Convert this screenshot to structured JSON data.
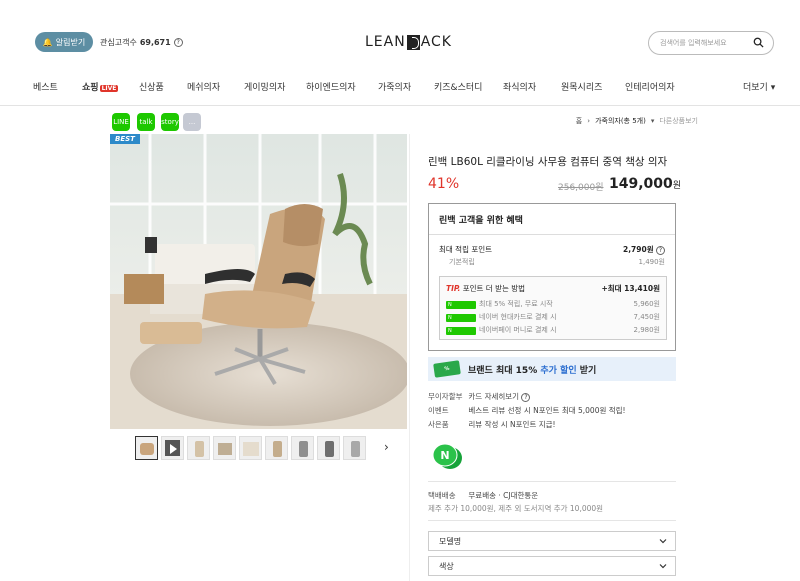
{
  "header": {
    "alarm_label": "알림받기",
    "fav_label": "관심고객수",
    "fav_count": "69,671",
    "logo_left": "LEAN",
    "logo_right": "ACK",
    "search_placeholder": "검색어를 입력해보세요"
  },
  "nav": {
    "items": [
      "베스트",
      "쇼핑",
      "신상품",
      "메쉬의자",
      "게이밍의자",
      "하이엔드의자",
      "가죽의자",
      "키즈&스터디",
      "좌식의자",
      "원목시리즈",
      "인테리어의자"
    ],
    "live_tag": "LIVE",
    "more": "더보기"
  },
  "breadcrumb": {
    "home": "홈",
    "category": "가죽의자(총 5개)",
    "next": "다른상품보기"
  },
  "share": [
    "LINE",
    "talk",
    "story",
    "blog",
    "..."
  ],
  "product": {
    "badge": "BEST",
    "title": "린백 LB60L 리클라이닝 사무용 컴퓨터 중역 책상 의자",
    "discount": "41%",
    "original_price": "256,000원",
    "price": "149,000",
    "price_unit": "원"
  },
  "benefit": {
    "title": "린백 고객을 위한 혜택",
    "max_point_label": "최대 적립 포인트",
    "max_point_value": "2,790원",
    "base_label": "기본적립",
    "base_value": "1,490원",
    "tip_label": "포인트 더 받는 방법",
    "tip_value": "+최대 13,410원",
    "tips": [
      {
        "text": "최대 5% 적립, 무료 시작",
        "value": "5,960원"
      },
      {
        "text": "네이버 현대카드로 결제 시",
        "value": "7,450원"
      },
      {
        "text": "네이버페이 머니로 결제 시",
        "value": "2,980원"
      }
    ]
  },
  "banner": {
    "pre": "브랜드 최대 15%",
    "highlight": "추가 할인",
    "post": "받기"
  },
  "meta": {
    "interest_label": "무이자할부",
    "interest_value": "카드 자세히보기",
    "event_label": "이벤트",
    "event_value": "베스트 리뷰 선정 시 N포인트 최대 5,000원 적립!",
    "gift_label": "사은품",
    "gift_value": "리뷰 작성 시 N포인트 지급!",
    "ship_label": "택배배송",
    "ship_value": "무료배송 · CJ대한통운",
    "ship_extra": "제주 추가 10,000원, 제주 외 도서지역 추가 10,000원"
  },
  "options": {
    "model": "모델명",
    "color": "색상"
  },
  "colors": {
    "accent_red": "#e0352b",
    "brand_green": "#1ec800",
    "banner_bg": "#e7f0fa"
  }
}
